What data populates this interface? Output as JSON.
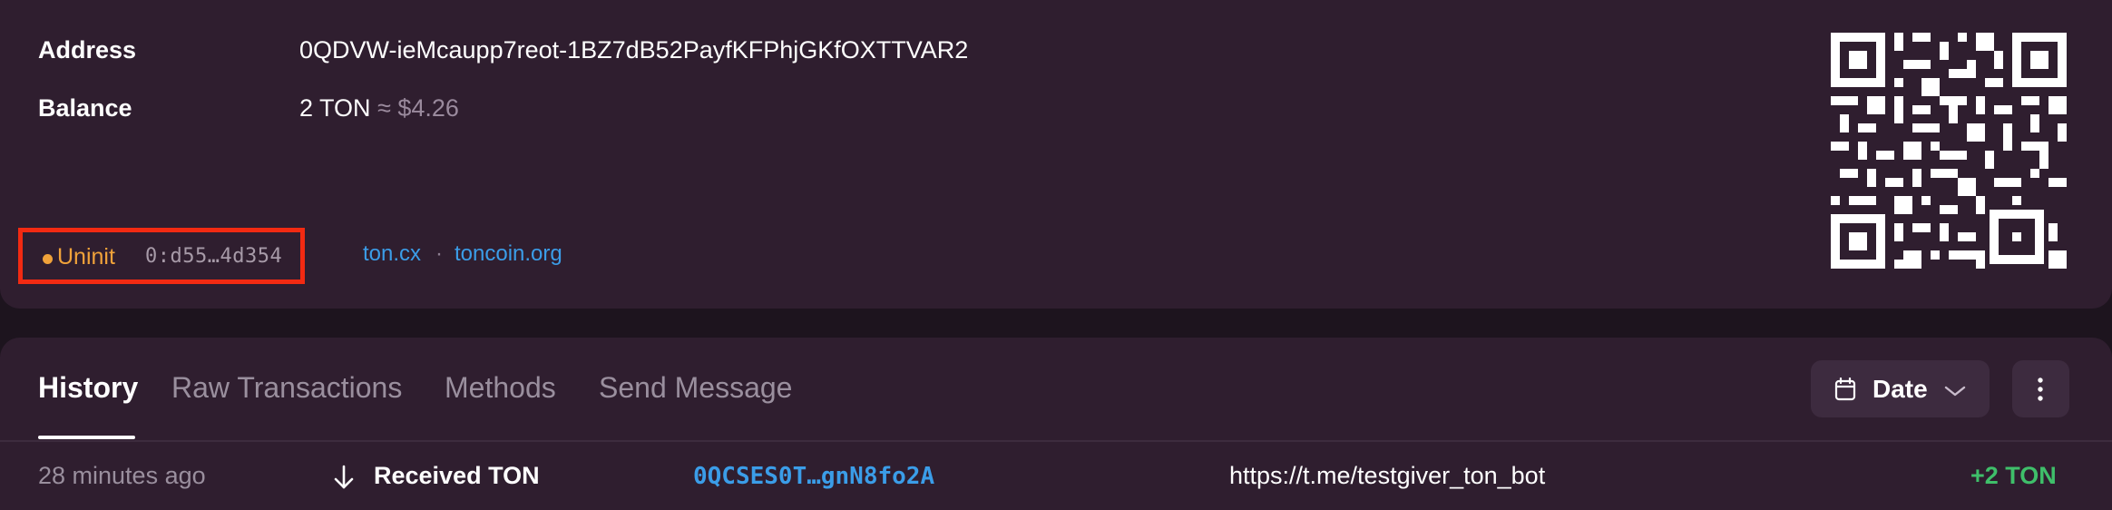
{
  "account": {
    "address_label": "Address",
    "address_value": "0QDVW-ieMcaupp7reot-1BZ7dB52PayfKFPhjGKfOXTTVAR2",
    "balance_label": "Balance",
    "balance_ton": "2 TON",
    "balance_fiat": "≈ $4.26",
    "status": "Uninit",
    "raw_address_short": "0:d55…4d354",
    "links": [
      {
        "label": "ton.cx"
      },
      {
        "label": "toncoin.org"
      }
    ],
    "link_separator": "·"
  },
  "tabs": [
    {
      "label": "History",
      "active": true
    },
    {
      "label": "Raw Transactions",
      "active": false
    },
    {
      "label": "Methods",
      "active": false
    },
    {
      "label": "Send Message",
      "active": false
    }
  ],
  "toolbar": {
    "date_label": "Date",
    "date_icon": "calendar-icon",
    "more_icon": "more-vertical-icon"
  },
  "history": [
    {
      "time": "28 minutes ago",
      "direction_icon": "arrow-down-icon",
      "action": "Received TON",
      "counterparty": "0QCSES0T…gnN8fo2A",
      "comment": "https://t.me/testgiver_ton_bot",
      "amount": "+2 TON"
    }
  ],
  "colors": {
    "background": "#1d141e",
    "card": "#2f1e2f",
    "accent_link": "#3b9de8",
    "status_uninit": "#f0a23a",
    "positive": "#3fbf6a",
    "highlight_border": "#f22a12"
  }
}
